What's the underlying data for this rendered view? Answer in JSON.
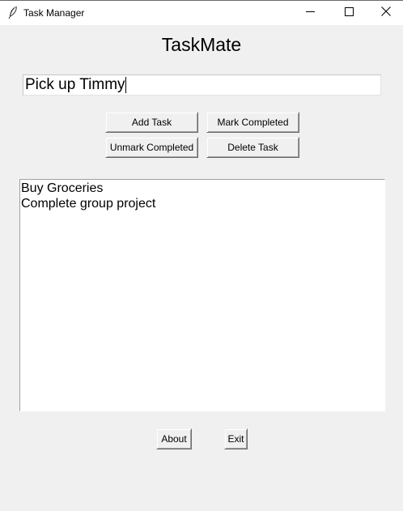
{
  "window": {
    "title": "Task Manager",
    "controls": {
      "minimize_icon": "minimize-icon",
      "maximize_icon": "maximize-icon",
      "close_icon": "close-icon"
    }
  },
  "app": {
    "title": "TaskMate"
  },
  "task_input": {
    "value": "Pick up Timmy"
  },
  "buttons": {
    "add_task": "Add Task",
    "mark_completed": "Mark Completed",
    "unmark_completed": "Unmark Completed",
    "delete_task": "Delete Task",
    "about": "About",
    "exit": "Exit"
  },
  "task_list": {
    "items": [
      "Buy Groceries",
      "Complete group project"
    ]
  },
  "colors": {
    "window_bg": "#f0f0f0",
    "list_bg": "#ffffff",
    "text": "#000000"
  }
}
